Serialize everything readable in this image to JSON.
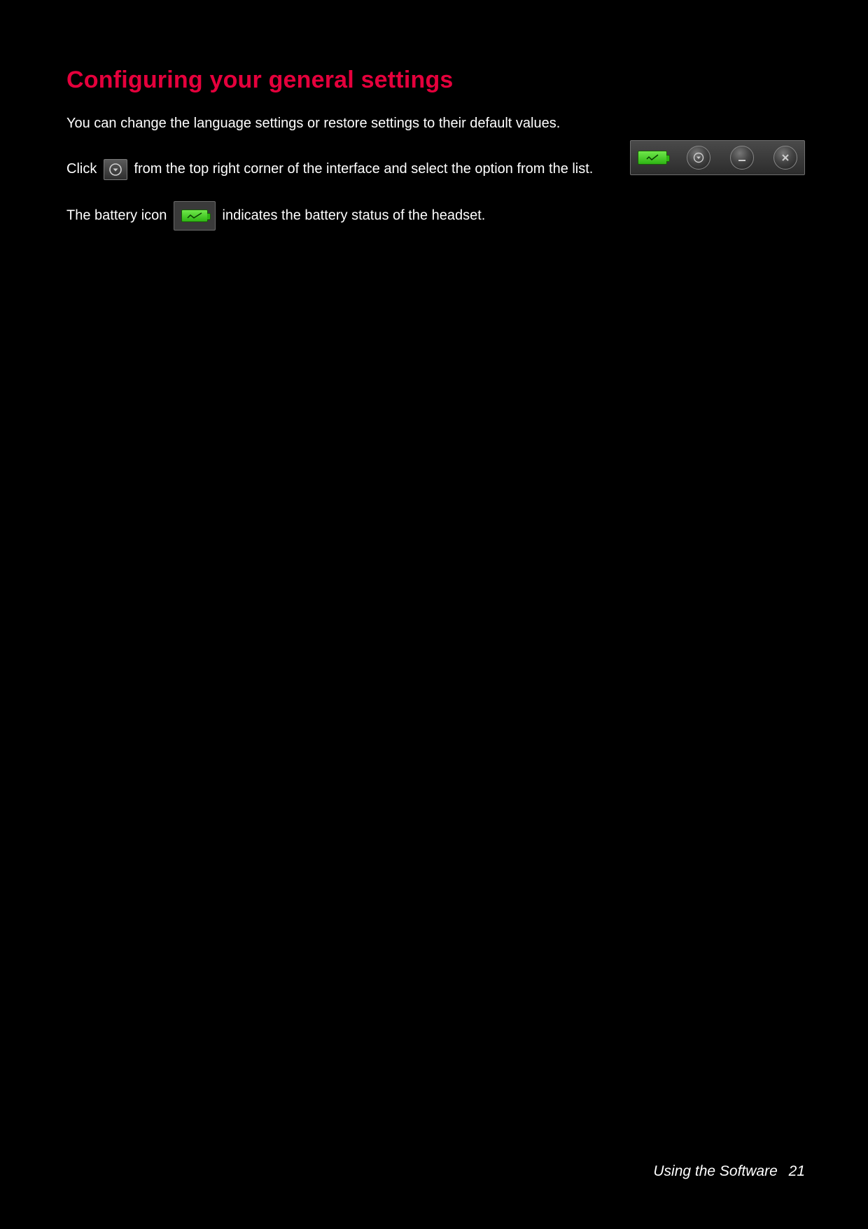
{
  "heading": "Configuring your general settings",
  "intro": "You can change the language settings or restore settings to their default values.",
  "para2": {
    "a": "Click",
    "b": "from the top right corner of the interface and select the option from the list."
  },
  "para3": {
    "a": "The battery icon",
    "b": "indicates the battery status of the headset."
  },
  "icons": {
    "settings_dropdown": "settings-dropdown-icon",
    "battery": "battery-icon",
    "minimize": "minimize-icon",
    "close": "close-icon"
  },
  "footer": {
    "section": "Using the Software",
    "page": "21"
  }
}
